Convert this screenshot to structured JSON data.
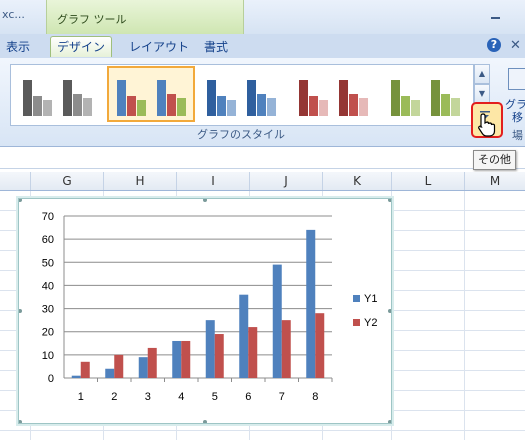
{
  "window": {
    "title": "xc..."
  },
  "tool_context": {
    "label": "グラフ ツール"
  },
  "tabs": [
    {
      "label": "表示"
    },
    {
      "label": "デザイン",
      "active": true
    },
    {
      "label": "レイアウト"
    },
    {
      "label": "書式"
    }
  ],
  "ribbon": {
    "gallery_group_label": "グラフのスタイル",
    "styles": [
      {
        "colors": [
          "#5a5a5a",
          "#8c8c8c",
          "#b3b3b3"
        ]
      },
      {
        "colors": [
          "#4f81bd",
          "#c0504d",
          "#9bbb59"
        ],
        "selected": true
      },
      {
        "colors": [
          "#2f5f9e",
          "#4f81bd",
          "#95b3d7"
        ]
      },
      {
        "colors": [
          "#943634",
          "#c0504d",
          "#e6b9b8"
        ]
      },
      {
        "colors": [
          "#76923c",
          "#9bbb59",
          "#c3d69b"
        ]
      }
    ],
    "move_label_line1": "グラフ",
    "move_label_line2": "移",
    "place_label": "場"
  },
  "tooltip": {
    "text": "その他"
  },
  "columns": [
    "G",
    "H",
    "I",
    "J",
    "K",
    "L",
    "M"
  ],
  "chart_data": {
    "type": "bar",
    "categories": [
      "1",
      "2",
      "3",
      "4",
      "5",
      "6",
      "7",
      "8"
    ],
    "series": [
      {
        "name": "Y1",
        "color": "#4f81bd",
        "values": [
          1,
          4,
          9,
          16,
          25,
          36,
          49,
          64
        ]
      },
      {
        "name": "Y2",
        "color": "#c0504d",
        "values": [
          7,
          10,
          13,
          16,
          19,
          22,
          25,
          28
        ]
      }
    ],
    "ylim": [
      0,
      70
    ],
    "yticks": [
      "0",
      "10",
      "20",
      "30",
      "40",
      "50",
      "60",
      "70"
    ],
    "grid": true,
    "legend": "right"
  }
}
